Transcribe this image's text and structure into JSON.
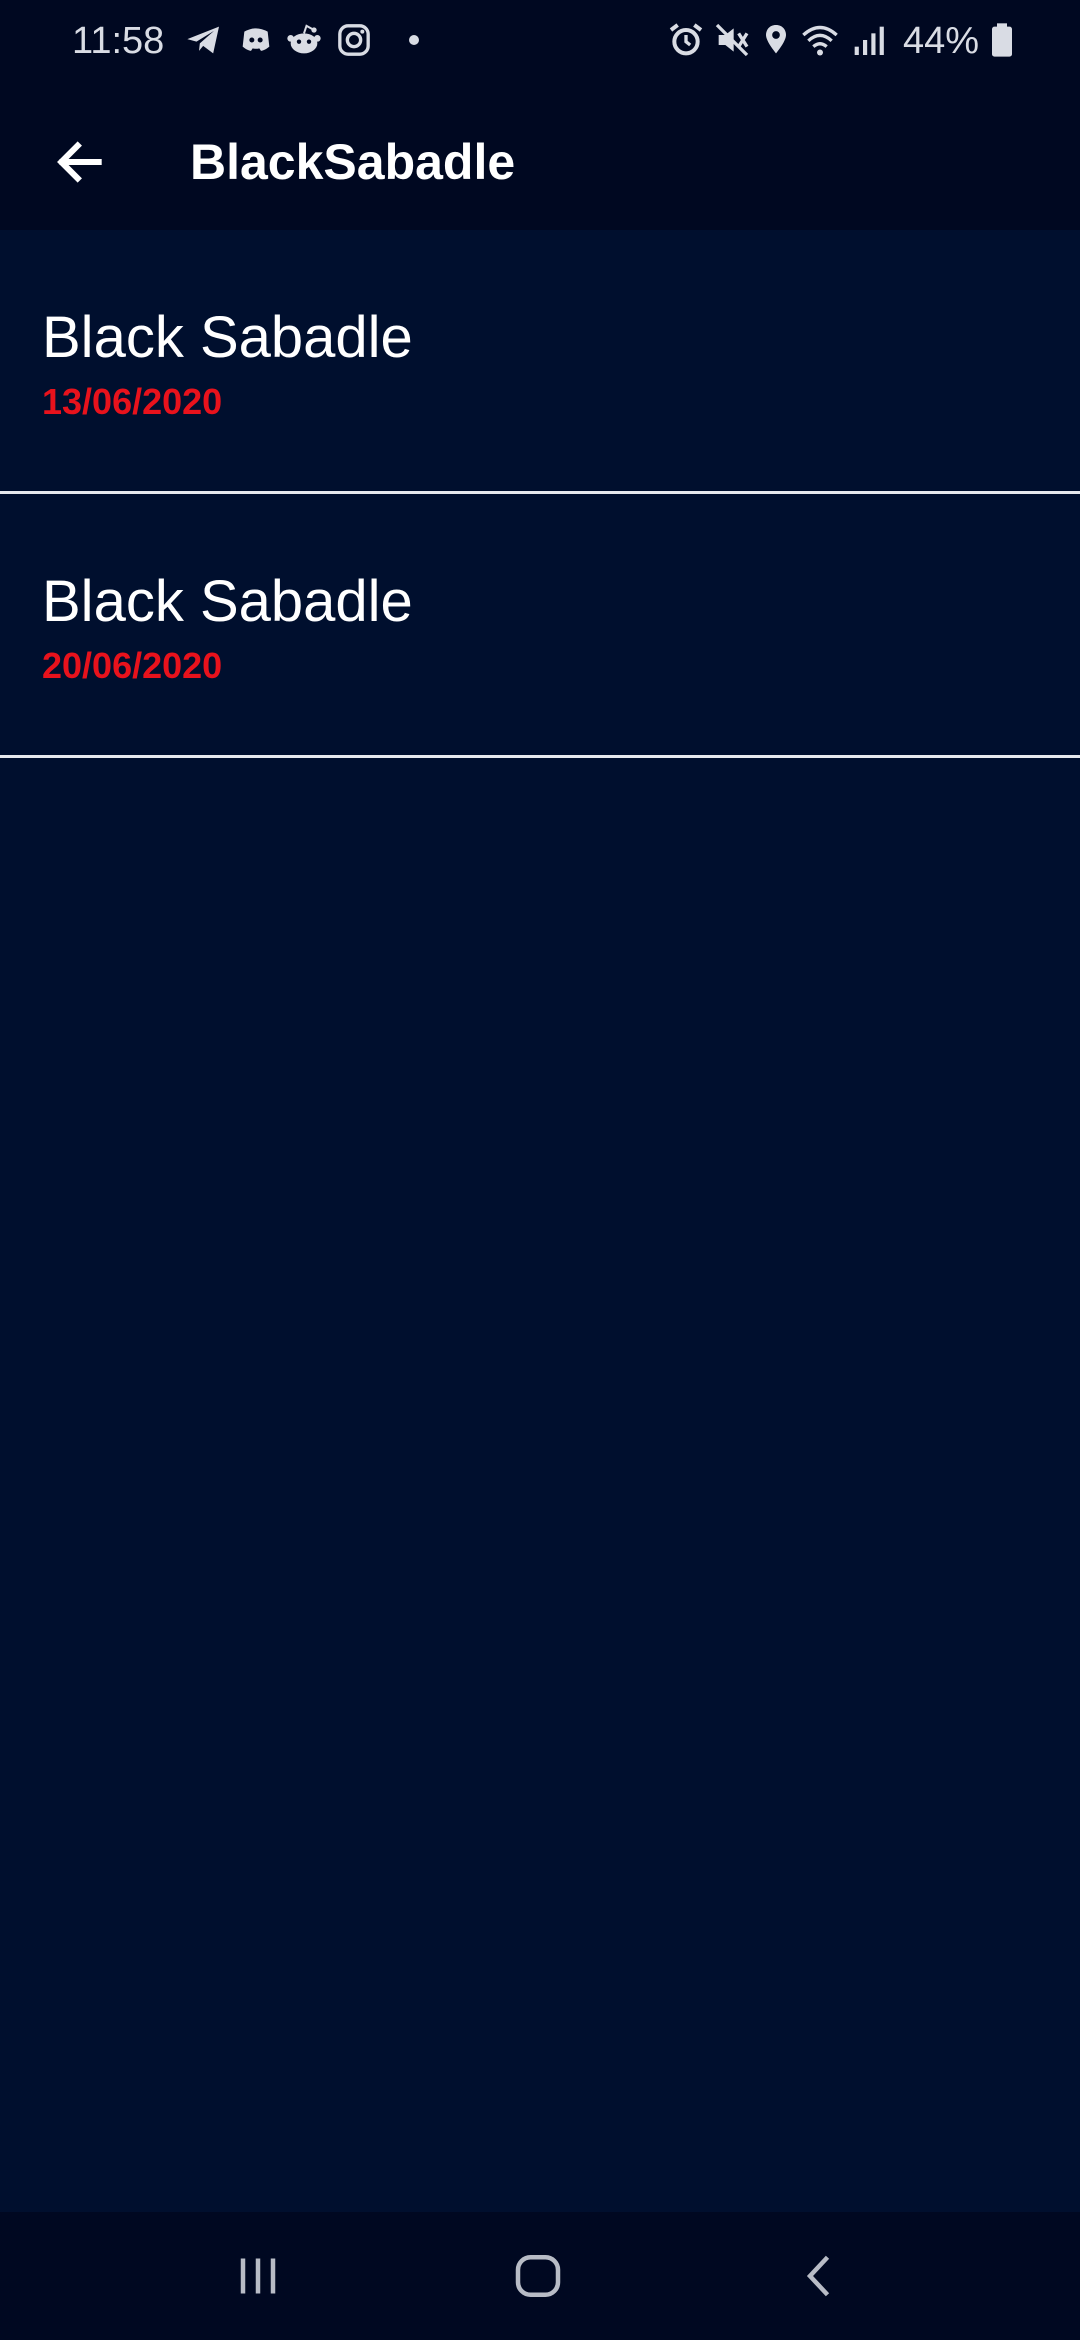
{
  "status_bar": {
    "time": "11:58",
    "battery_percent": "44%",
    "left_icons": [
      "telegram-icon",
      "discord-icon",
      "reddit-icon",
      "instagram-icon",
      "dot-icon"
    ],
    "right_icons": [
      "alarm-icon",
      "vibrate-mute-icon",
      "location-icon",
      "wifi-icon",
      "signal-icon",
      "battery-icon"
    ]
  },
  "app_bar": {
    "title": "BlackSabadle",
    "back_icon": "arrow-back-icon"
  },
  "list": {
    "items": [
      {
        "title": "Black Sabadle",
        "date": "13/06/2020"
      },
      {
        "title": "Black Sabadle",
        "date": "20/06/2020"
      }
    ]
  },
  "nav_bar": {
    "icons": [
      "recent-apps-icon",
      "home-icon",
      "back-icon"
    ]
  },
  "colors": {
    "background": "#000f2e",
    "bar": "#000821",
    "date": "#e8121c",
    "divider": "#e6e8ee"
  }
}
